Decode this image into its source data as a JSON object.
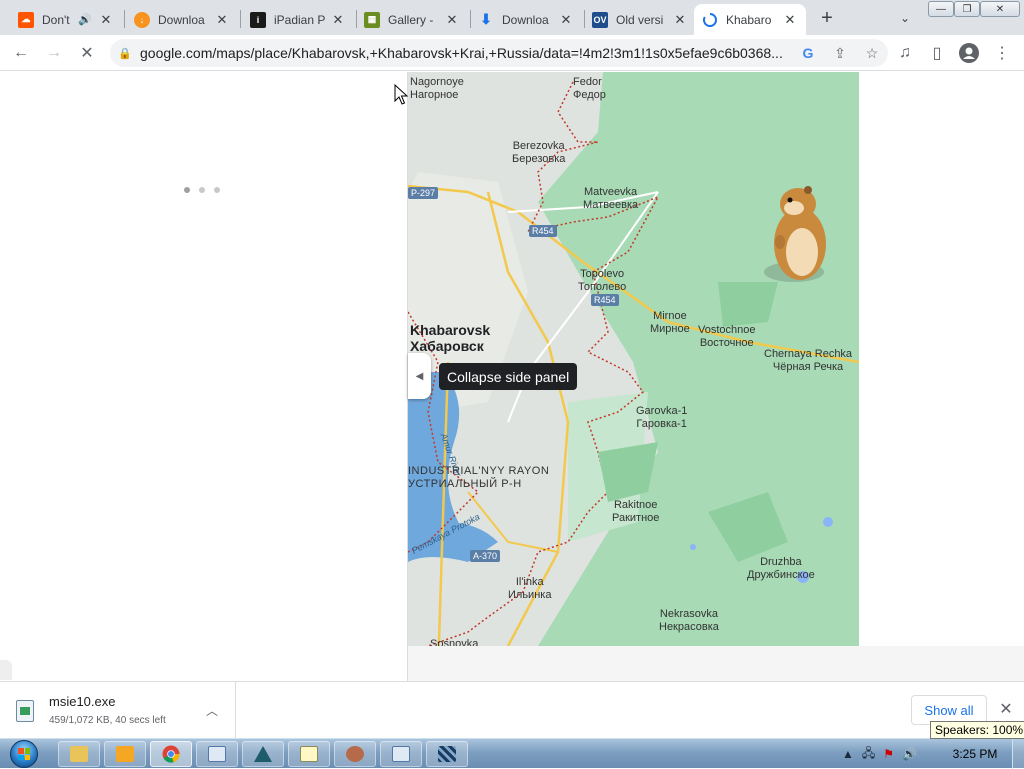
{
  "browser": {
    "tabs": [
      {
        "title": "Don't",
        "icon": "soundcloud-icon",
        "color": "#ff5500",
        "audio": true
      },
      {
        "title": "Downloa",
        "icon": "download-orange-icon",
        "color": "#f7931e"
      },
      {
        "title": "iPadian P",
        "icon": "ipadian-icon",
        "color": "#1a1a1a"
      },
      {
        "title": "Gallery -",
        "icon": "gallery-icon",
        "color": "#6b8e23"
      },
      {
        "title": "Downloa",
        "icon": "download-blue-icon",
        "color": "#1a73e8"
      },
      {
        "title": "Old versi",
        "icon": "oldversion-icon",
        "color": "#1f4e8c"
      },
      {
        "title": "Khabaro",
        "icon": "loading-spinner-icon",
        "color": "#1a73e8",
        "active": true
      }
    ],
    "omnibox": {
      "url": "google.com/maps/place/Khabarovsk,+Khabarovsk+Krai,+Russia/data=!4m2!3m1!1s0x5efae9c6b0368..."
    }
  },
  "map": {
    "tooltip": "Collapse side panel",
    "places": [
      {
        "name": "Nagornoye",
        "local": "Нагорное"
      },
      {
        "name": "Fedor",
        "local": "Федор"
      },
      {
        "name": "Berezovka",
        "local": "Березовка"
      },
      {
        "name": "Matveevka",
        "local": "Матвеевка"
      },
      {
        "name": "Topolevo",
        "local": "Тополево"
      },
      {
        "name": "Mirnoe",
        "local": "Мирное"
      },
      {
        "name": "Vostochnoe",
        "local": "Восточное"
      },
      {
        "name": "Chernaya Rechka",
        "local": "Чёрная Речка"
      },
      {
        "name": "Khabarovsk",
        "local": "Хабаровск"
      },
      {
        "name": "Garovka-1",
        "local": "Гаровка-1"
      },
      {
        "name": "INDUSTRIAL'NYY RAYON",
        "local": "УСТРИАЛЬНЫЙ Р-Н"
      },
      {
        "name": "Rakitnoe",
        "local": "Ракитное"
      },
      {
        "name": "Druzhba",
        "local": "Дружбинское"
      },
      {
        "name": "Il'inka",
        "local": "Ильинка"
      },
      {
        "name": "Nekrasovka",
        "local": "Некрасовка"
      },
      {
        "name": "Sosnovka",
        "local": ""
      }
    ],
    "roads": [
      "P-297",
      "R454",
      "R454",
      "A-370"
    ],
    "water": [
      "Amur River",
      "Pemskaya Protoka"
    ]
  },
  "download": {
    "file": "msie10.exe",
    "status": "459/1,072 KB, 40 secs left",
    "show_all": "Show all"
  },
  "tooltip_speakers": "Speakers: 100%",
  "taskbar": {
    "clock": "3:25 PM"
  },
  "colors": {
    "map_green": "#a8dab5",
    "map_land": "#e8eae6",
    "water": "#6fa8dc",
    "border_dotted": "#c0392b",
    "accent": "#1a73e8"
  }
}
